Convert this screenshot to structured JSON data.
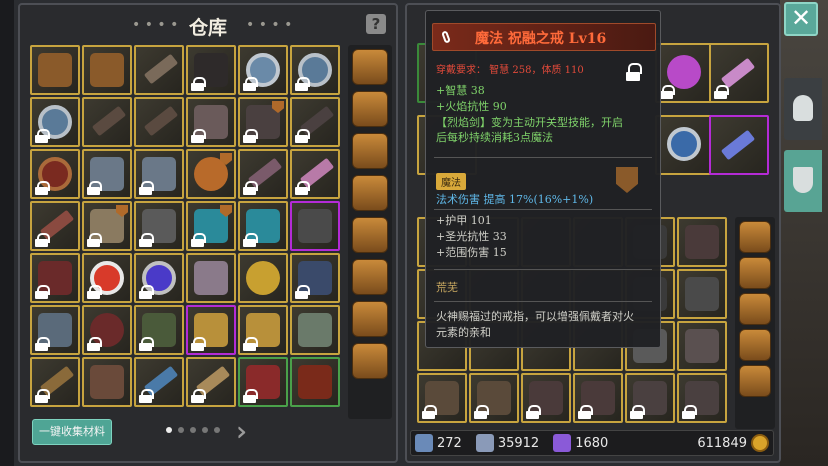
{
  "warehouse": {
    "title": "仓库",
    "title_left_dots": "• • • •",
    "title_right_dots": "• • • •",
    "help_label": "?",
    "collect_button": "一键收集材料",
    "page_count": 5,
    "active_page": 1
  },
  "tooltip": {
    "title": "魔法 祝融之戒 Lv16",
    "requirement": "穿戴要求： 智慧 258，体质 110",
    "stat1": "+智慧 38",
    "stat2": "+火焰抗性 90",
    "skill_line1": "【烈焰剑】变为主动开关型技能，开启",
    "skill_line2": "后每秒持续消耗3点魔法",
    "tag": "魔法",
    "tag_desc": "法术伤害 提高 17%(16%+1%)",
    "stat3": "+护甲 101",
    "stat4": "+圣光抗性 33",
    "stat5": "+范围伤害 15",
    "rarity_name": "荒芜",
    "desc_line1": "火神赐福过的戒指，可以增强佩戴者对火",
    "desc_line2": "元素的亲和"
  },
  "stats": {
    "attack": "272",
    "defense": "35912",
    "crystals": "1680",
    "gold": "611849"
  },
  "close_label": "✕",
  "colors": {
    "accent_teal": "#4fa595",
    "border_gold": "#c7a43f",
    "border_purple": "#b42bd6",
    "tooltip_title": "#ff6a3a",
    "requirement_red": "#e24a3a",
    "stat_green": "#7fd36a"
  }
}
